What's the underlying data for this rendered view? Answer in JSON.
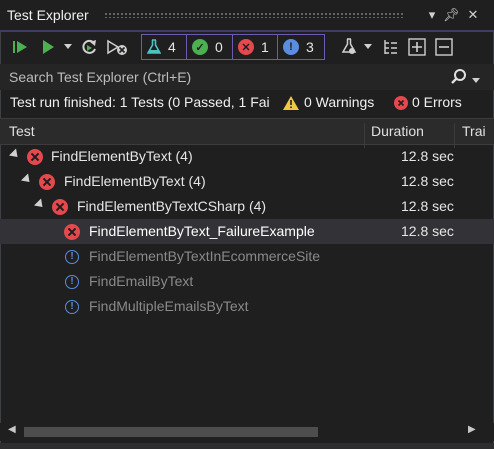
{
  "window": {
    "title": "Test Explorer"
  },
  "toolbar": {
    "groups": [
      {
        "name": "total",
        "count": "4"
      },
      {
        "name": "passed",
        "count": "0"
      },
      {
        "name": "failed",
        "count": "1"
      },
      {
        "name": "not_run",
        "count": "3"
      }
    ]
  },
  "search": {
    "placeholder": "Search Test Explorer (Ctrl+E)"
  },
  "summary": {
    "status": "Test run finished: 1 Tests (0 Passed, 1 Fai",
    "warnings": "0 Warnings",
    "errors": "0 Errors"
  },
  "columns": {
    "test": "Test",
    "duration": "Duration",
    "traits": "Trai"
  },
  "rows": [
    {
      "label": "FindElementByText",
      "count": "(4)",
      "duration": "12.8 sec",
      "status": "failed"
    },
    {
      "label": "FindElementByText",
      "count": "(4)",
      "duration": "12.8 sec",
      "status": "failed"
    },
    {
      "label": "FindElementByTextCSharp",
      "count": "(4)",
      "duration": "12.8 sec",
      "status": "failed"
    },
    {
      "label": "FindElementByText_FailureExample",
      "count": "",
      "duration": "12.8 sec",
      "status": "failed"
    },
    {
      "label": "FindElementByTextInEcommerceSite",
      "count": "",
      "duration": "",
      "status": "not_run"
    },
    {
      "label": "FindEmailByText",
      "count": "",
      "duration": "",
      "status": "not_run"
    },
    {
      "label": "FindMultipleEmailsByText",
      "count": "",
      "duration": "",
      "status": "not_run"
    }
  ],
  "colors": {
    "fail": "#e5484d",
    "pass": "#4caf50",
    "notrun": "#5a8de0",
    "accent": "#6d5ab3",
    "flask": "#4cc2c2"
  },
  "icons": [
    "run-all-icon",
    "run-icon",
    "rerun-icon",
    "cancel-icon",
    "flask-icon",
    "check-icon",
    "fail-icon",
    "info-icon",
    "settings-icon",
    "hierarchy-icon",
    "expand-all-icon",
    "collapse-all-icon",
    "search-icon"
  ]
}
